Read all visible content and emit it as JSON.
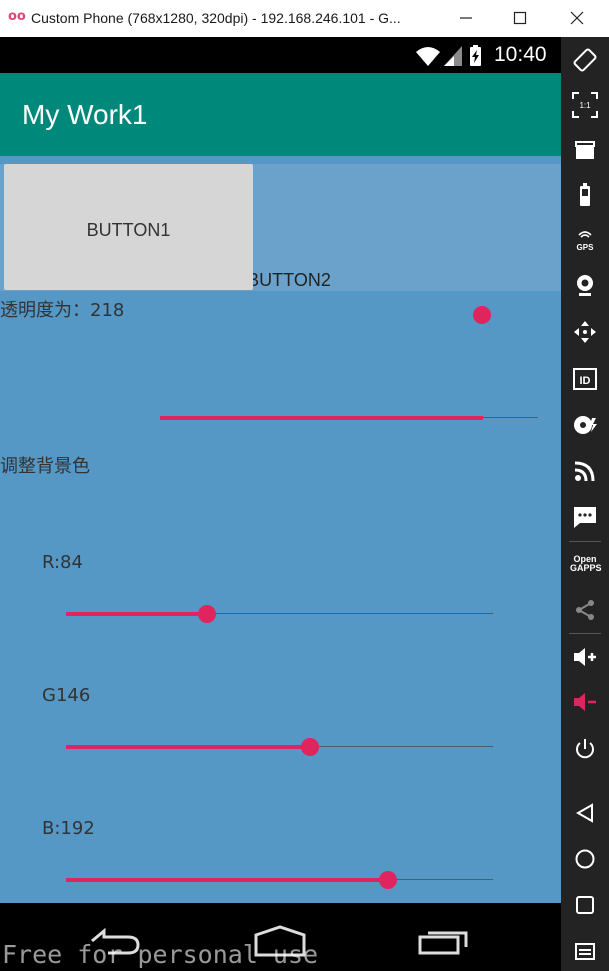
{
  "window": {
    "app_icon": "oo",
    "title": "Custom Phone (768x1280, 320dpi) - 192.168.246.101 - G...",
    "minimize_icon": "minimize-icon",
    "maximize_icon": "maximize-icon",
    "close_icon": "close-icon"
  },
  "statusbar": {
    "time": "10:40",
    "icons": [
      "wifi-icon",
      "signal-icon",
      "battery-charging-icon"
    ]
  },
  "app": {
    "title": "My Work1",
    "primary_color": "#00897b",
    "background_color": "#5597c5",
    "accent_color": "#e0245e"
  },
  "buttons": {
    "button1": "BUTTON1",
    "button2": "BUTTON2"
  },
  "alpha": {
    "label": "透明度为：218",
    "value": 218,
    "max": 255
  },
  "bg_section": {
    "label": "调整背景色"
  },
  "rgb": {
    "r": {
      "label": "R:84",
      "value": 84,
      "max": 255
    },
    "g": {
      "label": "G146",
      "value": 146,
      "max": 255
    },
    "b": {
      "label": "B:192",
      "value": 192,
      "max": 255
    }
  },
  "navbar": {
    "icons": [
      "back-icon",
      "home-icon",
      "recents-icon"
    ]
  },
  "sidebar": {
    "items": [
      {
        "icon": "rotate-icon"
      },
      {
        "icon": "scale-icon",
        "text": "1:1"
      },
      {
        "icon": "screen-record-icon"
      },
      {
        "icon": "battery-icon"
      },
      {
        "icon": "gps-icon",
        "text": "GPS"
      },
      {
        "icon": "camera-icon"
      },
      {
        "icon": "move-icon"
      },
      {
        "icon": "id-icon",
        "text": "ID"
      },
      {
        "icon": "disk-icon"
      },
      {
        "icon": "rss-icon"
      },
      {
        "icon": "sms-icon"
      },
      {
        "icon": "opengapps-icon",
        "text": "Open GAPPS"
      },
      {
        "icon": "share-icon"
      },
      {
        "icon": "volume-up-icon"
      },
      {
        "icon": "volume-down-icon"
      },
      {
        "icon": "power-icon"
      },
      {
        "icon": "back-icon"
      },
      {
        "icon": "home-icon"
      },
      {
        "icon": "recents-icon"
      },
      {
        "icon": "menu-icon"
      }
    ]
  },
  "watermark": "Free for personal use"
}
